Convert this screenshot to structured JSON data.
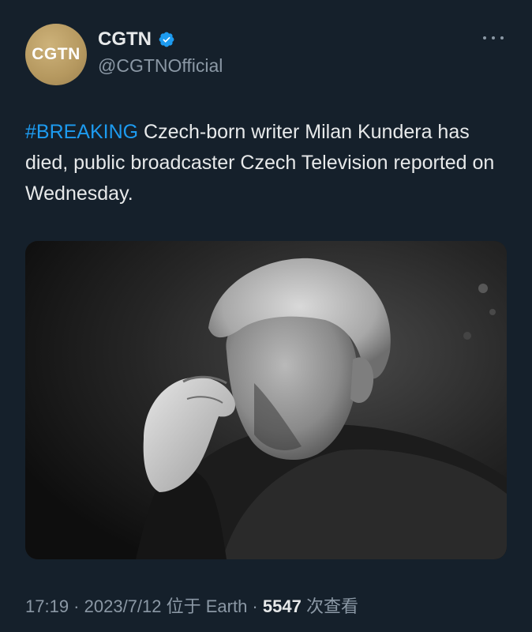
{
  "author": {
    "avatar_text": "CGTN",
    "display_name": "CGTN",
    "handle": "@CGTNOfficial",
    "verified": true
  },
  "tweet": {
    "hashtag": "#BREAKING",
    "text": " Czech-born writer Milan Kundera has died, public broadcaster Czech Television reported on Wednesday."
  },
  "meta": {
    "time": "17:19",
    "sep1": " · ",
    "date": "2023/7/12",
    "location": " 位于 Earth",
    "sep2": " · ",
    "views_count": "5547",
    "views_label": " 次查看"
  },
  "colors": {
    "background": "#15202b",
    "accent": "#1d9bf0",
    "secondary_text": "#8b98a5",
    "avatar_gold": "#b5985f"
  },
  "icons": {
    "verified": "verified-badge-icon",
    "more": "more-options-icon"
  }
}
